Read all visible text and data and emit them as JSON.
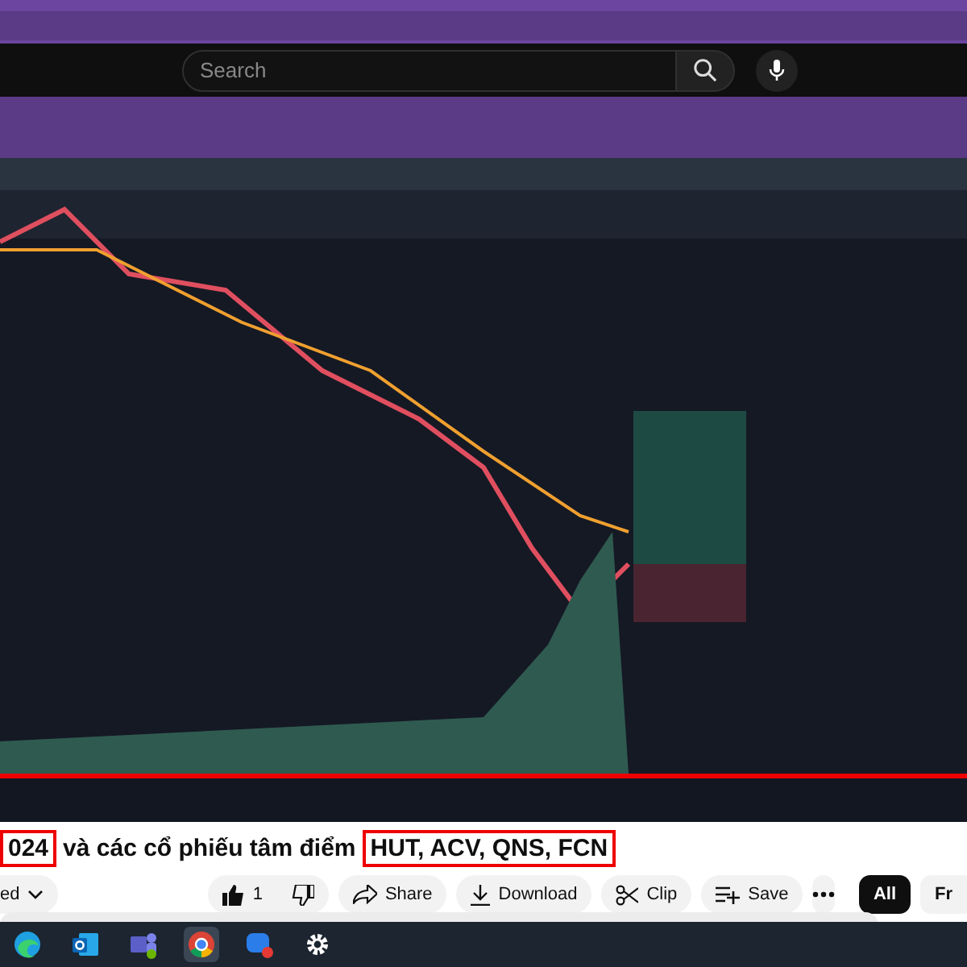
{
  "search": {
    "placeholder": "Search"
  },
  "title_parts": [
    {
      "text": "024",
      "highlighted": true
    },
    {
      "text": "và các cổ phiếu tâm điểm",
      "highlighted": false
    },
    {
      "text": "HUT, ACV, QNS, FCN",
      "highlighted": true
    }
  ],
  "subscribe": {
    "label": "ed"
  },
  "actions": [
    {
      "kind": "like",
      "label": "1"
    },
    {
      "kind": "dislike"
    },
    {
      "kind": "share",
      "label": "Share"
    },
    {
      "kind": "download",
      "label": "Download"
    },
    {
      "kind": "clip",
      "label": "Clip"
    },
    {
      "kind": "save",
      "label": "Save"
    },
    {
      "kind": "more"
    }
  ],
  "chips": [
    {
      "label": "All",
      "selected": true
    },
    {
      "label": "Fr",
      "selected": false
    }
  ],
  "taskbar": [
    {
      "kind": "edge",
      "selected": false
    },
    {
      "kind": "mail",
      "selected": false
    },
    {
      "kind": "team",
      "selected": false
    },
    {
      "kind": "chrome",
      "selected": true
    },
    {
      "kind": "chat",
      "selected": false
    },
    {
      "kind": "gear",
      "selected": false
    }
  ]
}
